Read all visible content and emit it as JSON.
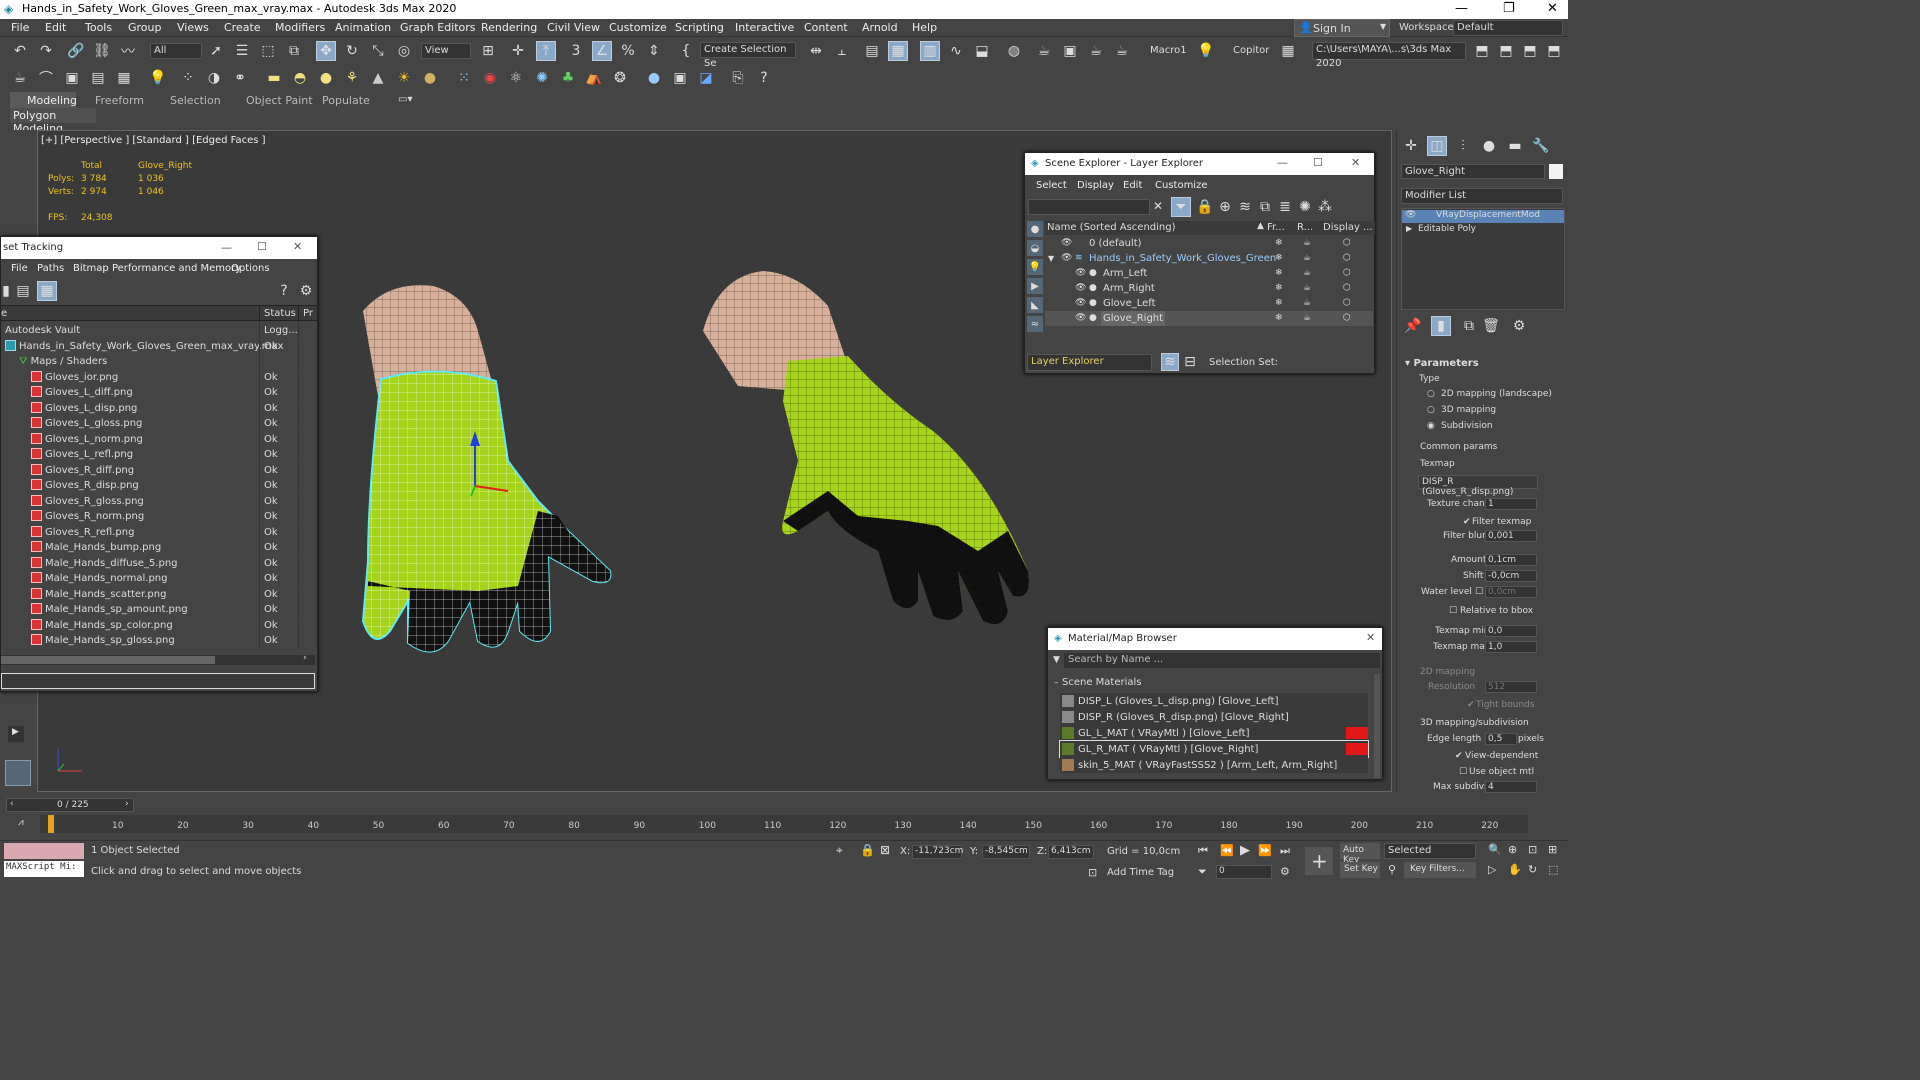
{
  "app": {
    "title": "Hands_in_Safety_Work_Gloves_Green_max_vray.max - Autodesk 3ds Max 2020"
  },
  "menubar": [
    "File",
    "Edit",
    "Tools",
    "Group",
    "Views",
    "Create",
    "Modifiers",
    "Animation",
    "Graph Editors",
    "Rendering",
    "Civil View",
    "Customize",
    "Scripting",
    "Interactive",
    "Content",
    "Arnold",
    "Help"
  ],
  "account": {
    "sign_in": "Sign In",
    "workspaces_label": "Workspaces:",
    "workspace": "Default"
  },
  "toolbar": {
    "selection_filter": "All",
    "ref_coord": "View",
    "named_selection": "Create Selection Se",
    "macro": "Macro1",
    "copitor": "Copitor",
    "project_path": "C:\\Users\\MAYA\\...s\\3ds Max 2020"
  },
  "ribbon": {
    "tabs": [
      "Modeling",
      "Freeform",
      "Selection",
      "Object Paint",
      "Populate"
    ],
    "sub": "Polygon Modeling"
  },
  "viewport": {
    "label": "[+] [Perspective ] [Standard ] [Edged Faces ]",
    "stats": {
      "total_label": "Total",
      "object_label": "Glove_Right",
      "polys_label": "Polys:",
      "polys_total": "3 784",
      "polys_obj": "1 036",
      "verts_label": "Verts:",
      "verts_total": "2 974",
      "verts_obj": "1 046",
      "fps_label": "FPS:",
      "fps": "24,308"
    }
  },
  "asset_tracking": {
    "title": "set Tracking",
    "menu": [
      "File",
      "Paths",
      "Bitmap Performance and Memory",
      "Options"
    ],
    "columns": [
      "e",
      "Status",
      "Pr"
    ],
    "rows": [
      {
        "name": "Autodesk Vault",
        "status": "Logg..."
      },
      {
        "name": "Hands_in_Safety_Work_Gloves_Green_max_vray.max",
        "status": "Ok"
      },
      {
        "name": "Maps / Shaders",
        "status": ""
      },
      {
        "name": "Gloves_ior.png",
        "status": "Ok"
      },
      {
        "name": "Gloves_L_diff.png",
        "status": "Ok"
      },
      {
        "name": "Gloves_L_disp.png",
        "status": "Ok"
      },
      {
        "name": "Gloves_L_gloss.png",
        "status": "Ok"
      },
      {
        "name": "Gloves_L_norm.png",
        "status": "Ok"
      },
      {
        "name": "Gloves_L_refl.png",
        "status": "Ok"
      },
      {
        "name": "Gloves_R_diff.png",
        "status": "Ok"
      },
      {
        "name": "Gloves_R_disp.png",
        "status": "Ok"
      },
      {
        "name": "Gloves_R_gloss.png",
        "status": "Ok"
      },
      {
        "name": "Gloves_R_norm.png",
        "status": "Ok"
      },
      {
        "name": "Gloves_R_refl.png",
        "status": "Ok"
      },
      {
        "name": "Male_Hands_bump.png",
        "status": "Ok"
      },
      {
        "name": "Male_Hands_diffuse_5.png",
        "status": "Ok"
      },
      {
        "name": "Male_Hands_normal.png",
        "status": "Ok"
      },
      {
        "name": "Male_Hands_scatter.png",
        "status": "Ok"
      },
      {
        "name": "Male_Hands_sp_amount.png",
        "status": "Ok"
      },
      {
        "name": "Male_Hands_sp_color.png",
        "status": "Ok"
      },
      {
        "name": "Male_Hands_sp_gloss.png",
        "status": "Ok"
      }
    ]
  },
  "scene_explorer": {
    "title": "Scene Explorer - Layer Explorer",
    "menu": [
      "Select",
      "Display",
      "Edit",
      "Customize"
    ],
    "columns": [
      "Name (Sorted Ascending)",
      "Fr...",
      "R...",
      "Display ..."
    ],
    "rows": [
      {
        "name": "0 (default)"
      },
      {
        "name": "Hands_in_Safety_Work_Gloves_Green"
      },
      {
        "name": "Arm_Left"
      },
      {
        "name": "Arm_Right"
      },
      {
        "name": "Glove_Left"
      },
      {
        "name": "Glove_Right"
      }
    ],
    "footer_explorer": "Layer Explorer",
    "selection_set_label": "Selection Set:"
  },
  "material_browser": {
    "title": "Material/Map Browser",
    "search_placeholder": "Search by Name ...",
    "section": "Scene Materials",
    "items": [
      "DISP_L (Gloves_L_disp.png) [Glove_Left]",
      "DISP_R (Gloves_R_disp.png) [Glove_Right]",
      "GL_L_MAT  ( VRayMtl )  [Glove_Left]",
      "GL_R_MAT  ( VRayMtl )  [Glove_Right]",
      "skin_5_MAT  ( VRayFastSSS2 ) [Arm_Left, Arm_Right]"
    ]
  },
  "command_panel": {
    "object_name": "Glove_Right",
    "modifier_list": "Modifier List",
    "stack": [
      "VRayDisplacementMod",
      "Editable Poly"
    ],
    "params_title": "Parameters",
    "type_label": "Type",
    "type_options": [
      "2D mapping (landscape)",
      "3D mapping",
      "Subdivision"
    ],
    "common_params": "Common params",
    "texmap_label": "Texmap",
    "texmap": "DISP_R (Gloves_R_disp.png)",
    "texture_chan_label": "Texture chan",
    "texture_chan": "1",
    "filter_texmap": "Filter texmap",
    "filter_blur_label": "Filter blur",
    "filter_blur": "0,001",
    "amount_label": "Amount",
    "amount": "0,1cm",
    "shift_label": "Shift",
    "shift": "-0,0cm",
    "water_label": "Water level",
    "water": "0,0cm",
    "relative_bbox": "Relative to bbox",
    "texmap_min_label": "Texmap min",
    "texmap_min": "0,0",
    "texmap_max_label": "Texmap max",
    "texmap_max": "1,0",
    "mapping2d": "2D mapping",
    "resolution_label": "Resolution",
    "resolution": "512",
    "tight_bounds": "Tight bounds",
    "mapping3d": "3D mapping/subdivision",
    "edge_length_label": "Edge length",
    "edge_length": "0,5",
    "pixels": "pixels",
    "view_dependent": "View-dependent",
    "use_object_mtl": "Use object mtl",
    "max_subdivs_label": "Max subdivs",
    "max_subdivs": "4"
  },
  "timeline": {
    "frame": "0 / 225",
    "ticks": [
      "10",
      "20",
      "30",
      "40",
      "50",
      "60",
      "70",
      "80",
      "90",
      "100",
      "110",
      "120",
      "130",
      "140",
      "150",
      "160",
      "170",
      "180",
      "190",
      "200",
      "210",
      "220"
    ]
  },
  "status": {
    "selected": "1 Object Selected",
    "prompt": "Click and drag to select and move objects",
    "maxscript": "MAXScript Mi:",
    "x_label": "X:",
    "x": "-11,723cm",
    "y_label": "Y:",
    "y": "-8,545cm",
    "z_label": "Z:",
    "z": "6,413cm",
    "grid": "Grid = 10,0cm",
    "add_time_tag": "Add Time Tag",
    "auto_key": "Auto Key",
    "set_key": "Set Key",
    "selected_mode": "Selected",
    "key_filters": "Key Filters...",
    "frame_field": "0"
  },
  "colors": {
    "glove": "#a6d41a",
    "select_cyan": "#5ee8f0",
    "skin": "#d8b09a"
  }
}
